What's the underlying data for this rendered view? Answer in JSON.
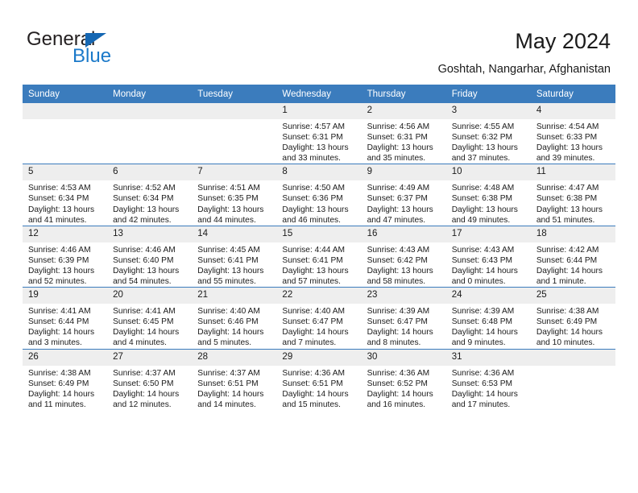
{
  "brand": {
    "name_top": "General",
    "name_bottom": "Blue",
    "accent_color": "#1b79c9",
    "triangle_color": "#1567b3"
  },
  "header": {
    "title": "May 2024",
    "location": "Goshtah, Nangarhar, Afghanistan",
    "header_bg_color": "#3b7cbd",
    "header_text_color": "#ffffff",
    "daynum_bg_color": "#eeeeee"
  },
  "weekday_headers": [
    "Sunday",
    "Monday",
    "Tuesday",
    "Wednesday",
    "Thursday",
    "Friday",
    "Saturday"
  ],
  "weeks": [
    [
      {
        "day": "",
        "empty": true,
        "sunrise": "",
        "sunset": "",
        "daylight": ""
      },
      {
        "day": "",
        "empty": true,
        "sunrise": "",
        "sunset": "",
        "daylight": ""
      },
      {
        "day": "",
        "empty": true,
        "sunrise": "",
        "sunset": "",
        "daylight": ""
      },
      {
        "day": "1",
        "empty": false,
        "sunrise": "Sunrise: 4:57 AM",
        "sunset": "Sunset: 6:31 PM",
        "daylight": "Daylight: 13 hours and 33 minutes."
      },
      {
        "day": "2",
        "empty": false,
        "sunrise": "Sunrise: 4:56 AM",
        "sunset": "Sunset: 6:31 PM",
        "daylight": "Daylight: 13 hours and 35 minutes."
      },
      {
        "day": "3",
        "empty": false,
        "sunrise": "Sunrise: 4:55 AM",
        "sunset": "Sunset: 6:32 PM",
        "daylight": "Daylight: 13 hours and 37 minutes."
      },
      {
        "day": "4",
        "empty": false,
        "sunrise": "Sunrise: 4:54 AM",
        "sunset": "Sunset: 6:33 PM",
        "daylight": "Daylight: 13 hours and 39 minutes."
      }
    ],
    [
      {
        "day": "5",
        "empty": false,
        "sunrise": "Sunrise: 4:53 AM",
        "sunset": "Sunset: 6:34 PM",
        "daylight": "Daylight: 13 hours and 41 minutes."
      },
      {
        "day": "6",
        "empty": false,
        "sunrise": "Sunrise: 4:52 AM",
        "sunset": "Sunset: 6:34 PM",
        "daylight": "Daylight: 13 hours and 42 minutes."
      },
      {
        "day": "7",
        "empty": false,
        "sunrise": "Sunrise: 4:51 AM",
        "sunset": "Sunset: 6:35 PM",
        "daylight": "Daylight: 13 hours and 44 minutes."
      },
      {
        "day": "8",
        "empty": false,
        "sunrise": "Sunrise: 4:50 AM",
        "sunset": "Sunset: 6:36 PM",
        "daylight": "Daylight: 13 hours and 46 minutes."
      },
      {
        "day": "9",
        "empty": false,
        "sunrise": "Sunrise: 4:49 AM",
        "sunset": "Sunset: 6:37 PM",
        "daylight": "Daylight: 13 hours and 47 minutes."
      },
      {
        "day": "10",
        "empty": false,
        "sunrise": "Sunrise: 4:48 AM",
        "sunset": "Sunset: 6:38 PM",
        "daylight": "Daylight: 13 hours and 49 minutes."
      },
      {
        "day": "11",
        "empty": false,
        "sunrise": "Sunrise: 4:47 AM",
        "sunset": "Sunset: 6:38 PM",
        "daylight": "Daylight: 13 hours and 51 minutes."
      }
    ],
    [
      {
        "day": "12",
        "empty": false,
        "sunrise": "Sunrise: 4:46 AM",
        "sunset": "Sunset: 6:39 PM",
        "daylight": "Daylight: 13 hours and 52 minutes."
      },
      {
        "day": "13",
        "empty": false,
        "sunrise": "Sunrise: 4:46 AM",
        "sunset": "Sunset: 6:40 PM",
        "daylight": "Daylight: 13 hours and 54 minutes."
      },
      {
        "day": "14",
        "empty": false,
        "sunrise": "Sunrise: 4:45 AM",
        "sunset": "Sunset: 6:41 PM",
        "daylight": "Daylight: 13 hours and 55 minutes."
      },
      {
        "day": "15",
        "empty": false,
        "sunrise": "Sunrise: 4:44 AM",
        "sunset": "Sunset: 6:41 PM",
        "daylight": "Daylight: 13 hours and 57 minutes."
      },
      {
        "day": "16",
        "empty": false,
        "sunrise": "Sunrise: 4:43 AM",
        "sunset": "Sunset: 6:42 PM",
        "daylight": "Daylight: 13 hours and 58 minutes."
      },
      {
        "day": "17",
        "empty": false,
        "sunrise": "Sunrise: 4:43 AM",
        "sunset": "Sunset: 6:43 PM",
        "daylight": "Daylight: 14 hours and 0 minutes."
      },
      {
        "day": "18",
        "empty": false,
        "sunrise": "Sunrise: 4:42 AM",
        "sunset": "Sunset: 6:44 PM",
        "daylight": "Daylight: 14 hours and 1 minute."
      }
    ],
    [
      {
        "day": "19",
        "empty": false,
        "sunrise": "Sunrise: 4:41 AM",
        "sunset": "Sunset: 6:44 PM",
        "daylight": "Daylight: 14 hours and 3 minutes."
      },
      {
        "day": "20",
        "empty": false,
        "sunrise": "Sunrise: 4:41 AM",
        "sunset": "Sunset: 6:45 PM",
        "daylight": "Daylight: 14 hours and 4 minutes."
      },
      {
        "day": "21",
        "empty": false,
        "sunrise": "Sunrise: 4:40 AM",
        "sunset": "Sunset: 6:46 PM",
        "daylight": "Daylight: 14 hours and 5 minutes."
      },
      {
        "day": "22",
        "empty": false,
        "sunrise": "Sunrise: 4:40 AM",
        "sunset": "Sunset: 6:47 PM",
        "daylight": "Daylight: 14 hours and 7 minutes."
      },
      {
        "day": "23",
        "empty": false,
        "sunrise": "Sunrise: 4:39 AM",
        "sunset": "Sunset: 6:47 PM",
        "daylight": "Daylight: 14 hours and 8 minutes."
      },
      {
        "day": "24",
        "empty": false,
        "sunrise": "Sunrise: 4:39 AM",
        "sunset": "Sunset: 6:48 PM",
        "daylight": "Daylight: 14 hours and 9 minutes."
      },
      {
        "day": "25",
        "empty": false,
        "sunrise": "Sunrise: 4:38 AM",
        "sunset": "Sunset: 6:49 PM",
        "daylight": "Daylight: 14 hours and 10 minutes."
      }
    ],
    [
      {
        "day": "26",
        "empty": false,
        "sunrise": "Sunrise: 4:38 AM",
        "sunset": "Sunset: 6:49 PM",
        "daylight": "Daylight: 14 hours and 11 minutes."
      },
      {
        "day": "27",
        "empty": false,
        "sunrise": "Sunrise: 4:37 AM",
        "sunset": "Sunset: 6:50 PM",
        "daylight": "Daylight: 14 hours and 12 minutes."
      },
      {
        "day": "28",
        "empty": false,
        "sunrise": "Sunrise: 4:37 AM",
        "sunset": "Sunset: 6:51 PM",
        "daylight": "Daylight: 14 hours and 14 minutes."
      },
      {
        "day": "29",
        "empty": false,
        "sunrise": "Sunrise: 4:36 AM",
        "sunset": "Sunset: 6:51 PM",
        "daylight": "Daylight: 14 hours and 15 minutes."
      },
      {
        "day": "30",
        "empty": false,
        "sunrise": "Sunrise: 4:36 AM",
        "sunset": "Sunset: 6:52 PM",
        "daylight": "Daylight: 14 hours and 16 minutes."
      },
      {
        "day": "31",
        "empty": false,
        "sunrise": "Sunrise: 4:36 AM",
        "sunset": "Sunset: 6:53 PM",
        "daylight": "Daylight: 14 hours and 17 minutes."
      },
      {
        "day": "",
        "empty": true,
        "sunrise": "",
        "sunset": "",
        "daylight": ""
      }
    ]
  ]
}
